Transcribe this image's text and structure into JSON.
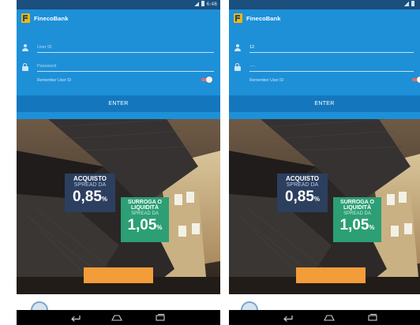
{
  "status_bar": {
    "time": "6:48"
  },
  "brand": {
    "name": "FinecoBank",
    "logo_letter": "F"
  },
  "screens": [
    {
      "user_id": {
        "value": "",
        "placeholder": "User ID"
      },
      "password": {
        "value": "",
        "placeholder": "Password"
      }
    },
    {
      "user_id": {
        "value": "12",
        "placeholder": "User ID"
      },
      "password": {
        "value": "····",
        "placeholder": "Password"
      }
    }
  ],
  "login": {
    "remember_label": "Remember User ID",
    "enter_label": "ENTER"
  },
  "promo": {
    "badge1": {
      "line1": "ACQUISTO",
      "line2": "SPREAD DA",
      "value": "0,85",
      "unit": "%"
    },
    "badge2": {
      "line1": "SURROGA O",
      "line1b": "LIQUIDITÀ",
      "line2": "SPREAD DA",
      "value": "1,05",
      "unit": "%"
    }
  },
  "icons": {
    "user": "user-icon",
    "lock": "lock-icon",
    "back": "back-icon",
    "home": "home-icon",
    "recents": "recents-icon"
  },
  "colors": {
    "app_blue": "#1e90d8",
    "enter_blue": "#1477bd",
    "status_bar": "#1a4f7e",
    "badge_navy": "#2c3f5f",
    "badge_green": "#2c9f75",
    "cta_orange": "#f39c3a",
    "toggle_red": "#e36a6a"
  }
}
